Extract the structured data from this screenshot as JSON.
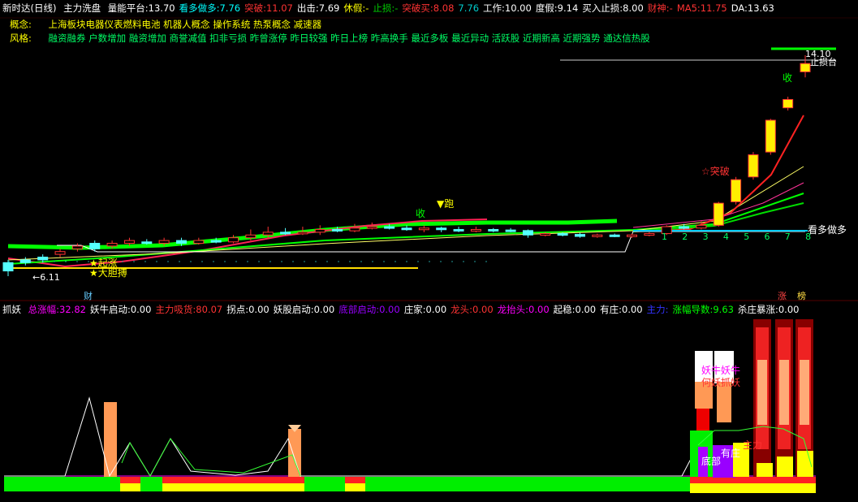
{
  "header": {
    "title": "新时达(日线)",
    "indicator": "主力洗盘",
    "items": [
      {
        "label": "量能平台:",
        "value": "13.70",
        "color": "#ffffff"
      },
      {
        "label": "看多做多:",
        "value": "7.76",
        "color": "#00ffff"
      },
      {
        "label": "突破:",
        "value": "11.07",
        "color": "#ff3333"
      },
      {
        "label": "出击:",
        "value": "7.69",
        "color": "#ffffff"
      },
      {
        "label": "休假:",
        "value": "-",
        "color": "#ffff00"
      },
      {
        "label": "止损:",
        "value": "-",
        "color": "#00cc00"
      },
      {
        "label": "突破买:",
        "value": "8.08",
        "color": "#ff3333"
      },
      {
        "label": "",
        "value": "7.76",
        "color": "#00cccc"
      },
      {
        "label": "工作:",
        "value": "10.00",
        "color": "#ffffff"
      },
      {
        "label": "度假:",
        "value": "9.14",
        "color": "#ffffff"
      },
      {
        "label": "买入止损:",
        "value": "8.00",
        "color": "#ffffff"
      },
      {
        "label": "财神:",
        "value": "-",
        "color": "#ff3333"
      },
      {
        "label": "MA5:",
        "value": "11.75",
        "color": "#ff3333"
      },
      {
        "label": "DA:",
        "value": "13.63",
        "color": "#ffffff"
      }
    ]
  },
  "concept": {
    "label": "概念:",
    "text": "上海板块电器仪表燃料电池 机器人概念 操作系统 热泵概念 减速器"
  },
  "style": {
    "label": "风格:",
    "text": "融资融券 户数增加 融资增加 商誉减值 扣非亏损 昨曾涨停 昨日较强 昨日上榜 昨高换手 最近多板 最近异动 活跃股 近期新高 近期强势 通达信热股"
  },
  "chart_annotations": {
    "price_high": "14.10",
    "price_low": "6.11",
    "zhisun": "止损台",
    "shou1": "收",
    "shou2": "收",
    "pao": "跑",
    "tupo": "突破",
    "kanduo": "看多做多",
    "tiaojia": "起涨",
    "dadan": "大胆搏",
    "cai": "财",
    "zhang": "涨",
    "bang": "榜",
    "day_numbers": [
      "1",
      "2",
      "3",
      "4",
      "5",
      "6",
      "7",
      "8"
    ]
  },
  "sub_header": {
    "name": "抓妖",
    "items": [
      {
        "label": "总涨幅:",
        "value": "32.82",
        "color": "#ff00ff"
      },
      {
        "label": "妖牛启动:",
        "value": "0.00",
        "color": "#ffffff"
      },
      {
        "label": "主力吸货:",
        "value": "80.07",
        "color": "#ff3333"
      },
      {
        "label": "拐点:",
        "value": "0.00",
        "color": "#ffffff"
      },
      {
        "label": "妖股启动:",
        "value": "0.00",
        "color": "#ffffff"
      },
      {
        "label": "底部启动:",
        "value": "0.00",
        "color": "#9900ff"
      },
      {
        "label": "庄家:",
        "value": "0.00",
        "color": "#ffffff"
      },
      {
        "label": "龙头:",
        "value": "0.00",
        "color": "#ff3333"
      },
      {
        "label": "龙抬头:",
        "value": "0.00",
        "color": "#ff00ff"
      },
      {
        "label": "起稳:",
        "value": "0.00",
        "color": "#ffffff"
      },
      {
        "label": "有庄:",
        "value": "0.00",
        "color": "#ffffff"
      },
      {
        "label": "主力:",
        "value": "",
        "color": "#3333ff"
      },
      {
        "label": "涨幅导数:",
        "value": "9.63",
        "color": "#00ff00"
      },
      {
        "label": "杀庄暴涨:",
        "value": "0.00",
        "color": "#ffffff"
      }
    ]
  },
  "sub_annotations": {
    "yaoniu": "妖牛妖牛",
    "hezhua": "何妖抓妖",
    "dibu": "底部",
    "youzhuang": "有庄",
    "zhuli": "主力"
  },
  "chart_data": {
    "type": "candlestick",
    "title": "新时达(日线)",
    "ylim": [
      6.11,
      14.1
    ],
    "candles": [
      {
        "o": 6.6,
        "c": 6.3,
        "h": 6.7,
        "l": 6.11
      },
      {
        "o": 6.7,
        "c": 6.6,
        "h": 6.8,
        "l": 6.5
      },
      {
        "o": 6.8,
        "c": 6.7,
        "h": 6.9,
        "l": 6.6
      },
      {
        "o": 6.9,
        "c": 7.0,
        "h": 7.1,
        "l": 6.8
      },
      {
        "o": 7.1,
        "c": 7.2,
        "h": 7.3,
        "l": 7.0
      },
      {
        "o": 7.3,
        "c": 7.1,
        "h": 7.4,
        "l": 7.0
      },
      {
        "o": 7.2,
        "c": 7.3,
        "h": 7.4,
        "l": 7.1
      },
      {
        "o": 7.3,
        "c": 7.4,
        "h": 7.5,
        "l": 7.2
      },
      {
        "o": 7.35,
        "c": 7.3,
        "h": 7.45,
        "l": 7.25
      },
      {
        "o": 7.3,
        "c": 7.4,
        "h": 7.5,
        "l": 7.2
      },
      {
        "o": 7.4,
        "c": 7.3,
        "h": 7.5,
        "l": 7.2
      },
      {
        "o": 7.3,
        "c": 7.4,
        "h": 7.5,
        "l": 7.25
      },
      {
        "o": 7.4,
        "c": 7.35,
        "h": 7.5,
        "l": 7.3
      },
      {
        "o": 7.35,
        "c": 7.5,
        "h": 7.6,
        "l": 7.3
      },
      {
        "o": 7.5,
        "c": 7.6,
        "h": 7.8,
        "l": 7.4
      },
      {
        "o": 7.6,
        "c": 7.7,
        "h": 7.9,
        "l": 7.5
      },
      {
        "o": 7.7,
        "c": 7.65,
        "h": 7.85,
        "l": 7.6
      },
      {
        "o": 7.65,
        "c": 7.7,
        "h": 7.9,
        "l": 7.6
      },
      {
        "o": 7.7,
        "c": 7.8,
        "h": 7.95,
        "l": 7.6
      },
      {
        "o": 7.8,
        "c": 7.75,
        "h": 7.9,
        "l": 7.7
      },
      {
        "o": 7.75,
        "c": 7.85,
        "h": 8.0,
        "l": 7.7
      },
      {
        "o": 7.85,
        "c": 7.9,
        "h": 8.05,
        "l": 7.8
      },
      {
        "o": 7.9,
        "c": 7.85,
        "h": 8.0,
        "l": 7.8
      },
      {
        "o": 7.85,
        "c": 7.8,
        "h": 7.95,
        "l": 7.75
      },
      {
        "o": 7.8,
        "c": 7.85,
        "h": 7.95,
        "l": 7.7
      },
      {
        "o": 7.85,
        "c": 7.8,
        "h": 7.9,
        "l": 7.7
      },
      {
        "o": 7.8,
        "c": 7.75,
        "h": 7.9,
        "l": 7.7
      },
      {
        "o": 7.75,
        "c": 7.8,
        "h": 7.9,
        "l": 7.7
      },
      {
        "o": 7.8,
        "c": 7.78,
        "h": 7.85,
        "l": 7.7
      },
      {
        "o": 7.78,
        "c": 7.76,
        "h": 7.85,
        "l": 7.7
      },
      {
        "o": 7.76,
        "c": 7.6,
        "h": 7.8,
        "l": 7.5
      },
      {
        "o": 7.6,
        "c": 7.65,
        "h": 7.7,
        "l": 7.55
      },
      {
        "o": 7.65,
        "c": 7.62,
        "h": 7.7,
        "l": 7.55
      },
      {
        "o": 7.62,
        "c": 7.55,
        "h": 7.68,
        "l": 7.5
      },
      {
        "o": 7.55,
        "c": 7.6,
        "h": 7.65,
        "l": 7.5
      },
      {
        "o": 7.6,
        "c": 7.58,
        "h": 7.65,
        "l": 7.52
      },
      {
        "o": 7.58,
        "c": 7.6,
        "h": 7.65,
        "l": 7.5
      },
      {
        "o": 7.6,
        "c": 7.65,
        "h": 7.7,
        "l": 7.55
      },
      {
        "o": 7.65,
        "c": 7.9,
        "h": 7.95,
        "l": 7.6
      },
      {
        "o": 7.9,
        "c": 7.85,
        "h": 8.0,
        "l": 7.8
      },
      {
        "o": 7.85,
        "c": 7.95,
        "h": 8.1,
        "l": 7.8
      },
      {
        "o": 7.95,
        "c": 8.75,
        "h": 8.8,
        "l": 7.9
      },
      {
        "o": 8.8,
        "c": 9.6,
        "h": 9.7,
        "l": 8.7
      },
      {
        "o": 9.7,
        "c": 10.5,
        "h": 10.6,
        "l": 9.6
      },
      {
        "o": 10.6,
        "c": 11.75,
        "h": 11.8,
        "l": 10.5
      },
      {
        "o": 12.2,
        "c": 12.5,
        "h": 12.6,
        "l": 12.1
      },
      {
        "o": 13.5,
        "c": 13.8,
        "h": 14.1,
        "l": 13.3
      }
    ]
  }
}
